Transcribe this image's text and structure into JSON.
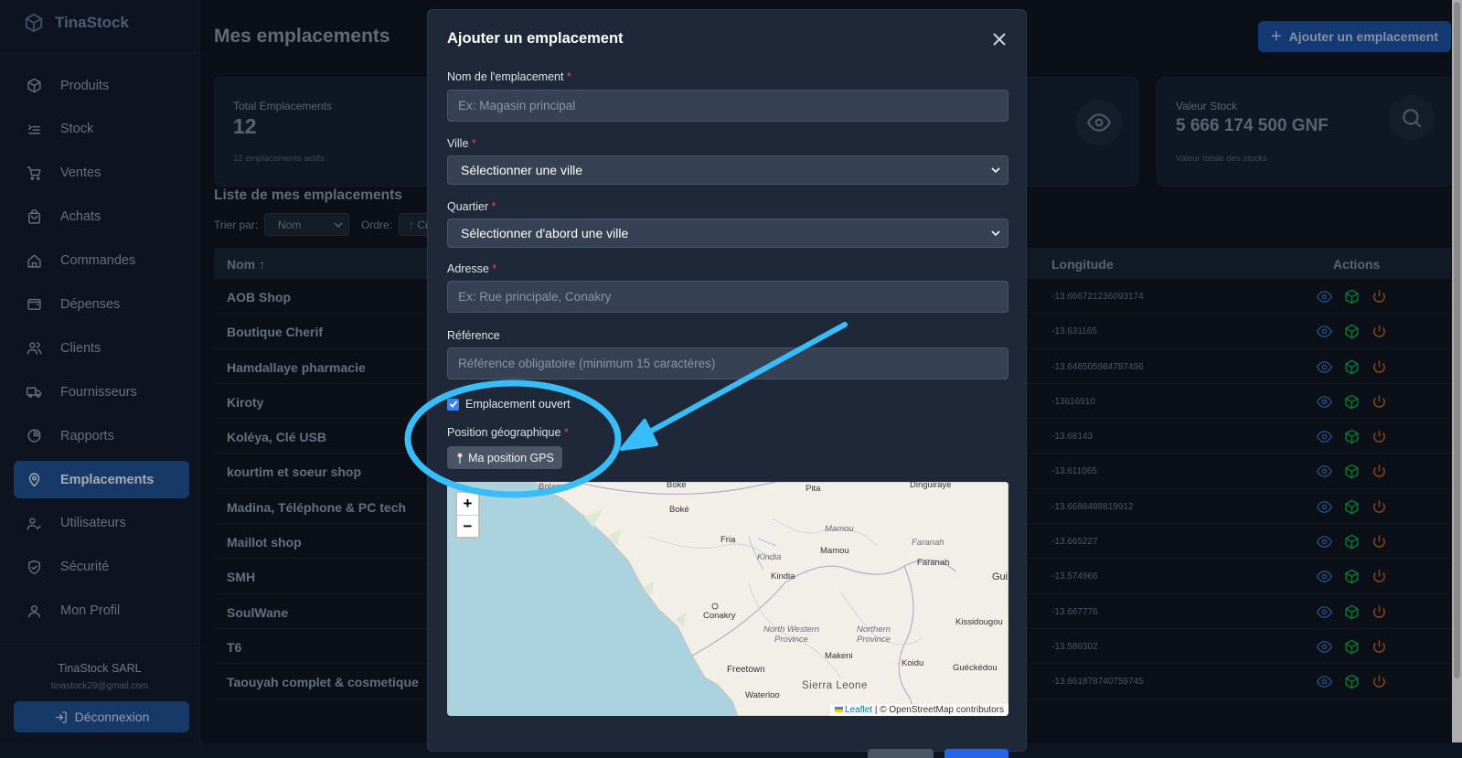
{
  "app": {
    "name": "TinaStock"
  },
  "sidebar": {
    "items": [
      {
        "label": "Produits",
        "icon": "box-icon"
      },
      {
        "label": "Stock",
        "icon": "list-icon"
      },
      {
        "label": "Ventes",
        "icon": "cart-icon"
      },
      {
        "label": "Achats",
        "icon": "bag-icon"
      },
      {
        "label": "Commandes",
        "icon": "home-icon"
      },
      {
        "label": "Dépenses",
        "icon": "wallet-icon"
      },
      {
        "label": "Clients",
        "icon": "users-icon"
      },
      {
        "label": "Fournisseurs",
        "icon": "truck-icon"
      },
      {
        "label": "Rapports",
        "icon": "pie-chart-icon"
      },
      {
        "label": "Emplacements",
        "icon": "map-pin-icon",
        "active": true
      },
      {
        "label": "Utilisateurs",
        "icon": "user-check-icon"
      },
      {
        "label": "Sécurité",
        "icon": "shield-icon"
      },
      {
        "label": "Mon Profil",
        "icon": "user-icon"
      }
    ],
    "company": "TinaStock SARL",
    "email": "tinastock29@gmail.com",
    "logout": "Déconnexion"
  },
  "header": {
    "title": "Mes emplacements",
    "add_button": "Ajouter un emplacement"
  },
  "stats": {
    "total_label": "Total Emplacements",
    "total_value": "12",
    "total_sub": "12 emplacements actifs",
    "stock_label": "Valeur Stock",
    "stock_value": "5 666 174 500 GNF",
    "stock_sub": "Valeur totale des stocks"
  },
  "list": {
    "title": "Liste de mes emplacements",
    "sort_label": "Trier par:",
    "sort_value": "Nom",
    "order_label": "Ordre:",
    "order_value": "↑ Cr",
    "columns": {
      "name": "Nom ↑",
      "longitude": "Longitude",
      "actions": "Actions"
    },
    "rows": [
      {
        "name": "AOB Shop",
        "longitude": "-13.666721236093174"
      },
      {
        "name": "Boutique Cherif",
        "longitude": "-13.631165"
      },
      {
        "name": "Hamdallaye pharmacie",
        "longitude": "-13.648505984787496"
      },
      {
        "name": "Kiroty",
        "longitude": "-13616910"
      },
      {
        "name": "Koléya, Clé USB",
        "longitude": "-13.68143"
      },
      {
        "name": "kourtim et soeur shop",
        "longitude": "-13.611065"
      },
      {
        "name": "Madina, Téléphone & PC tech",
        "longitude": "-13.6688488819912"
      },
      {
        "name": "Maillot shop",
        "longitude": "-13.665227"
      },
      {
        "name": "SMH",
        "longitude": "-13.574966"
      },
      {
        "name": "SoulWane",
        "longitude": "-13.667776"
      },
      {
        "name": "T6",
        "longitude": "-13.580302"
      },
      {
        "name": "Taouyah complet & cosmetique",
        "longitude": "-13.661878740759745"
      }
    ]
  },
  "modal": {
    "title": "Ajouter un emplacement",
    "name_label": "Nom de l'emplacement",
    "name_placeholder": "Ex: Magasin principal",
    "city_label": "Ville",
    "city_value": "Sélectionner une ville",
    "district_label": "Quartier",
    "district_value": "Sélectionner d'abord une ville",
    "address_label": "Adresse",
    "address_placeholder": "Ex: Rue principale, Conakry",
    "reference_label": "Référence",
    "reference_placeholder": "Référence obligatoire (minimum 15 caractères)",
    "open_label": "Emplacement ouvert",
    "open_checked": true,
    "geo_label": "Position géographique",
    "gps_button": "Ma position GPS",
    "required_mark": "*"
  },
  "map": {
    "zoom_in": "+",
    "zoom_out": "−",
    "attribution_link": "Leaflet",
    "attribution_text": "| © OpenStreetMap contributors",
    "places": {
      "bolama": "Bolama",
      "boke_top": "Boke",
      "pita": "Pita",
      "dinguiraye": "Dinguiraye",
      "boke": "Boké",
      "mamou_it": "Mamou",
      "mamou": "Mamou",
      "faranah_it": "Faranah",
      "faranah": "Faranah",
      "fria": "Fria",
      "kindia_it": "Kindia",
      "kindia": "Kindia",
      "gui": "Gui",
      "conakry": "Conakry",
      "kissidougou": "Kissidougou",
      "northern_western": "North Western",
      "province_1": "Province",
      "northern": "Northern",
      "province_2": "Province",
      "makeni": "Makeni",
      "freetown": "Freetown",
      "koidu": "Koidu",
      "gueckedou": "Guéckédou",
      "waterloo": "Waterloo",
      "sierra_leone": "Sierra Leone"
    }
  },
  "colors": {
    "accent": "#1d4fa0",
    "annotation": "#38bdf8",
    "sidebar_active": "#1f4f8f"
  }
}
